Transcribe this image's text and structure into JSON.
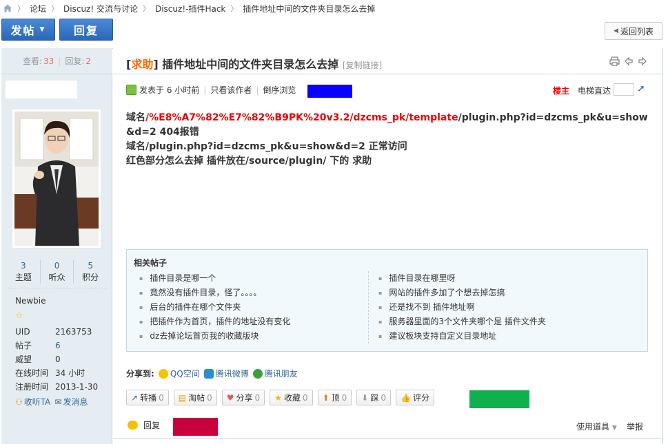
{
  "breadcrumb": {
    "items": [
      "论坛",
      "Discuz! 交流与讨论",
      "Discuz!-插件Hack",
      "插件地址中间的文件夹目录怎么去掉"
    ]
  },
  "toolbar": {
    "post_label": "发帖",
    "reply_label": "回复",
    "back_label": "返回列表"
  },
  "thread": {
    "views_label": "查看:",
    "views": "33",
    "replies_label": "回复:",
    "replies": "2",
    "type": "求助",
    "title": "插件地址中间的文件夹目录怎么去掉",
    "copy_link": "[复制链接]"
  },
  "author": {
    "stats": [
      {
        "value": "3",
        "label": "主题"
      },
      {
        "value": "0",
        "label": "听众"
      },
      {
        "value": "5",
        "label": "积分"
      }
    ],
    "group": "Newbie",
    "info": [
      {
        "key": "UID",
        "value": "2163753"
      },
      {
        "key": "帖子",
        "value": "6"
      },
      {
        "key": "威望",
        "value": "0"
      },
      {
        "key": "在线时间",
        "value": "34 小时"
      },
      {
        "key": "注册时间",
        "value": "2013-1-30"
      }
    ],
    "follow_label": "收听TA",
    "message_label": "发消息"
  },
  "post": {
    "posted": "发表于 6 小时前",
    "only_author": "只看该作者",
    "reverse": "倒序浏览",
    "louzhu": "楼主",
    "elevator": "电梯直达",
    "line1_prefix": "域名",
    "line1_red": "/%E8%A7%82%E7%82%B9PK%20v3.2/dzcms_pk/template",
    "line1_suffix": "/plugin.php?id=dzcms_pk&u=show&d=2  404报错",
    "line2": "域名/plugin.php?id=dzcms_pk&u=show&d=2  正常访问",
    "line3": "红色部分怎么去掉  插件放在/source/plugin/ 下的   求助"
  },
  "related": {
    "title": "相关帖子",
    "left": [
      "插件目录是哪一个",
      "竟然没有插件目录，怪了。。。。",
      "后台的插件在哪个文件夹",
      "把插件作为首页，插件的地址没有变化",
      "dz去掉论坛首页我的收藏版块"
    ],
    "right": [
      "插件目录在哪里呀",
      "网站的插件多加了个想去掉怎搞",
      "还是找不到 插件地址啊",
      "服务器里面的3个文件夹哪个是 插件文件夹",
      "建议板块支持自定义目录地址"
    ]
  },
  "share": {
    "label": "分享到:",
    "items": [
      "QQ空间",
      "腾讯微博",
      "腾讯朋友"
    ]
  },
  "actions": [
    {
      "label": "转播",
      "count": "0"
    },
    {
      "label": "淘帖",
      "count": "0"
    },
    {
      "label": "分享",
      "count": "0"
    },
    {
      "label": "收藏",
      "count": "0"
    },
    {
      "label": "顶",
      "count": "0"
    },
    {
      "label": "踩",
      "count": "0"
    },
    {
      "label": "评分",
      "count": ""
    }
  ],
  "footer": {
    "reply": "回复",
    "tools": "使用道具",
    "report": "举报"
  },
  "colors": {
    "accent_blue": "#0a00ff",
    "accent_green": "#10b050",
    "accent_crimson": "#c8003c"
  }
}
